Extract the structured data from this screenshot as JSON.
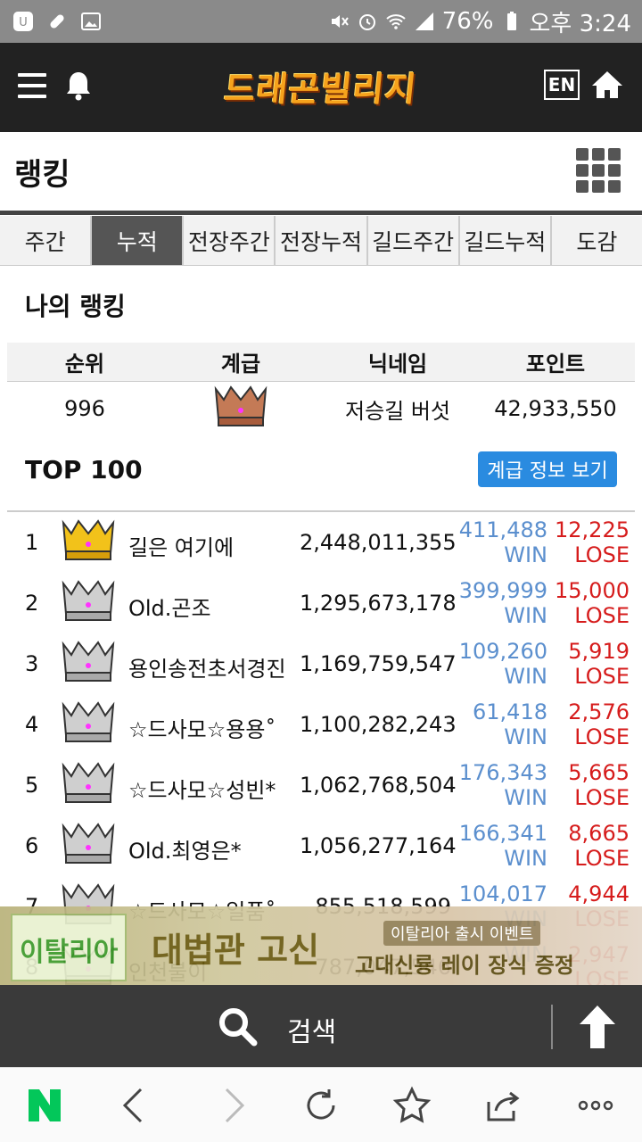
{
  "status_bar": {
    "battery": "76%",
    "time": "오후 3:24"
  },
  "header": {
    "logo_text": "드래곤빌리지",
    "lang_button": "EN"
  },
  "page": {
    "title": "랭킹"
  },
  "tabs": [
    {
      "label": "주간",
      "active": false
    },
    {
      "label": "누적",
      "active": true
    },
    {
      "label": "전장주간",
      "active": false
    },
    {
      "label": "전장누적",
      "active": false
    },
    {
      "label": "길드주간",
      "active": false
    },
    {
      "label": "길드누적",
      "active": false
    },
    {
      "label": "도감",
      "active": false
    }
  ],
  "my_ranking": {
    "heading": "나의 랭킹",
    "columns": [
      "순위",
      "계급",
      "닉네임",
      "포인트"
    ],
    "row": {
      "rank": "996",
      "grade_icon": "crown-bronze-icon",
      "nickname": "저승길 버섯",
      "points": "42,933,550"
    }
  },
  "top100": {
    "heading": "TOP 100",
    "grade_info_button": "계급 정보 보기",
    "rows": [
      {
        "rank": "1",
        "grade_icon": "crown-gold-icon",
        "name": "길은 여기에",
        "points": "2,448,011,355",
        "win": "411,488",
        "win_label": "WIN",
        "lose": "12,225",
        "lose_label": "LOSE"
      },
      {
        "rank": "2",
        "grade_icon": "crown-silver-icon",
        "name": "Old.곤조",
        "points": "1,295,673,178",
        "win": "399,999",
        "win_label": "WIN",
        "lose": "15,000",
        "lose_label": "LOSE"
      },
      {
        "rank": "3",
        "grade_icon": "crown-silver-icon",
        "name": "용인송전초서경진",
        "points": "1,169,759,547",
        "win": "109,260",
        "win_label": "WIN",
        "lose": "5,919",
        "lose_label": "LOSE"
      },
      {
        "rank": "4",
        "grade_icon": "crown-silver-icon",
        "name": "☆드사모☆용용˚",
        "points": "1,100,282,243",
        "win": "61,418",
        "win_label": "WIN",
        "lose": "2,576",
        "lose_label": "LOSE"
      },
      {
        "rank": "5",
        "grade_icon": "crown-silver-icon",
        "name": "☆드사모☆성빈*",
        "points": "1,062,768,504",
        "win": "176,343",
        "win_label": "WIN",
        "lose": "5,665",
        "lose_label": "LOSE"
      },
      {
        "rank": "6",
        "grade_icon": "crown-silver-icon",
        "name": "Old.최영은*",
        "points": "1,056,277,164",
        "win": "166,341",
        "win_label": "WIN",
        "lose": "8,665",
        "lose_label": "LOSE"
      },
      {
        "rank": "7",
        "grade_icon": "crown-silver-icon",
        "name": "☆드사모☆일품˚",
        "points": "855,518,599",
        "win": "104,017",
        "win_label": "WIN",
        "lose": "4,944",
        "lose_label": "LOSE"
      },
      {
        "rank": "8",
        "grade_icon": "crown-silver-icon",
        "name": "인천불이",
        "points": "787,047,546",
        "win": "",
        "win_label": "WIN",
        "lose": "2,947",
        "lose_label": "LOSE"
      }
    ]
  },
  "ad_banner": {
    "brand": "이탈리아",
    "headline": "대법관 고신",
    "sub_badge": "이탈리아 출시 이벤트",
    "sub_text": "고대신룡 레이 장식 증정"
  },
  "search_bar": {
    "label": "검색"
  },
  "colors": {
    "header_bg": "#222222",
    "active_tab": "#555555",
    "button_blue": "#2a8be0",
    "win_blue": "#5b8fce",
    "lose_red": "#d61c1c",
    "naver_green": "#03c75a"
  }
}
